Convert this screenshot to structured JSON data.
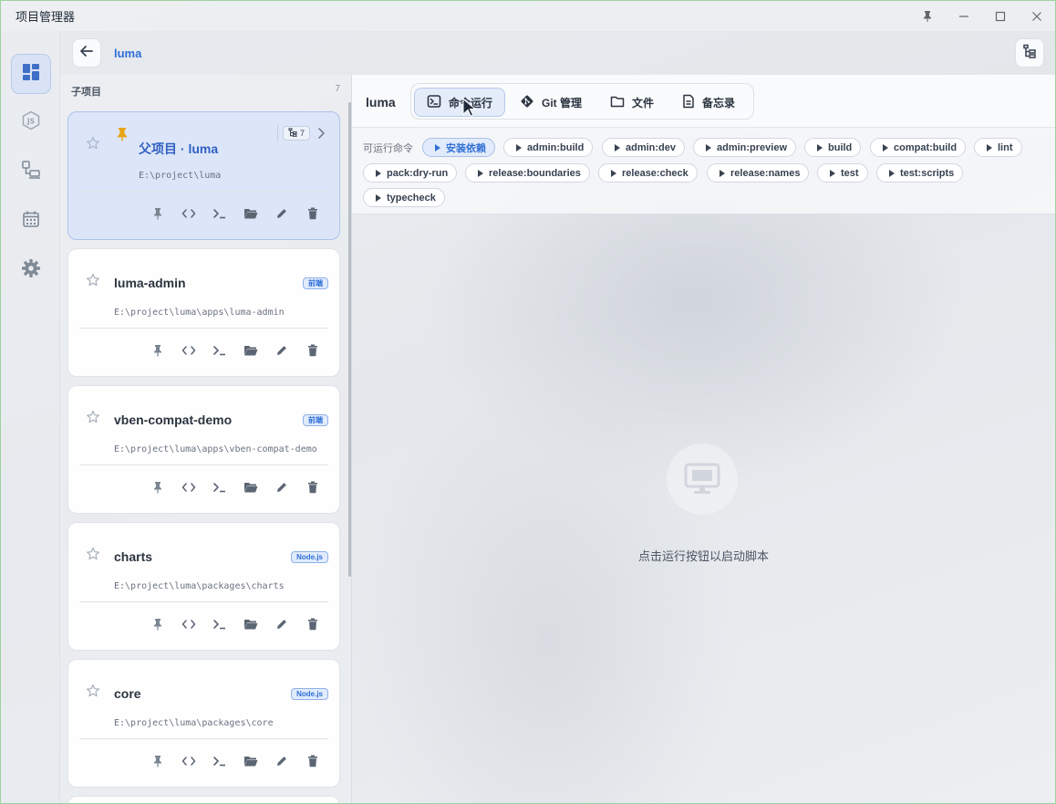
{
  "window": {
    "title": "项目管理器"
  },
  "titlebar_controls": [
    "pin-icon",
    "minimize-icon",
    "maximize-icon",
    "close-icon"
  ],
  "rail": {
    "items": [
      {
        "name": "dashboard",
        "icon": "dashboard-icon",
        "active": true
      },
      {
        "name": "js",
        "icon": "js-icon",
        "active": false
      },
      {
        "name": "devices",
        "icon": "devices-icon",
        "active": false
      },
      {
        "name": "calendar",
        "icon": "calendar-icon",
        "active": false
      },
      {
        "name": "settings",
        "icon": "gear-icon",
        "active": false
      }
    ]
  },
  "header": {
    "breadcrumb": "luma"
  },
  "subprojects": {
    "title": "子项目",
    "count": "7",
    "parent": {
      "name": "父项目 · luma",
      "path": "E:\\project\\luma",
      "child_count": "7"
    },
    "items": [
      {
        "name": "luma-admin",
        "path": "E:\\project\\luma\\apps\\luma-admin",
        "badge": "前端"
      },
      {
        "name": "vben-compat-demo",
        "path": "E:\\project\\luma\\apps\\vben-compat-demo",
        "badge": "前端"
      },
      {
        "name": "charts",
        "path": "E:\\project\\luma\\packages\\charts",
        "badge": "Node.js"
      },
      {
        "name": "core",
        "path": "E:\\project\\luma\\packages\\core",
        "badge": "Node.js"
      }
    ]
  },
  "main": {
    "project": "luma",
    "tabs": [
      {
        "label": "命令运行",
        "icon": "terminal-icon",
        "active": true
      },
      {
        "label": "Git 管理",
        "icon": "git-icon",
        "active": false
      },
      {
        "label": "文件",
        "icon": "folder-icon",
        "active": false
      },
      {
        "label": "备忘录",
        "icon": "note-icon",
        "active": false
      }
    ],
    "commands_label": "可运行命令",
    "commands": [
      "安装依赖",
      "admin:build",
      "admin:dev",
      "admin:preview",
      "build",
      "compat:build",
      "lint",
      "pack:dry-run",
      "release:boundaries",
      "release:check",
      "release:names",
      "test",
      "test:scripts",
      "typecheck"
    ],
    "empty_text": "点击运行按钮以启动脚本"
  },
  "colors": {
    "accent": "#2f6fd6",
    "pin": "#e8a417",
    "window_border": "#9fd19f"
  }
}
